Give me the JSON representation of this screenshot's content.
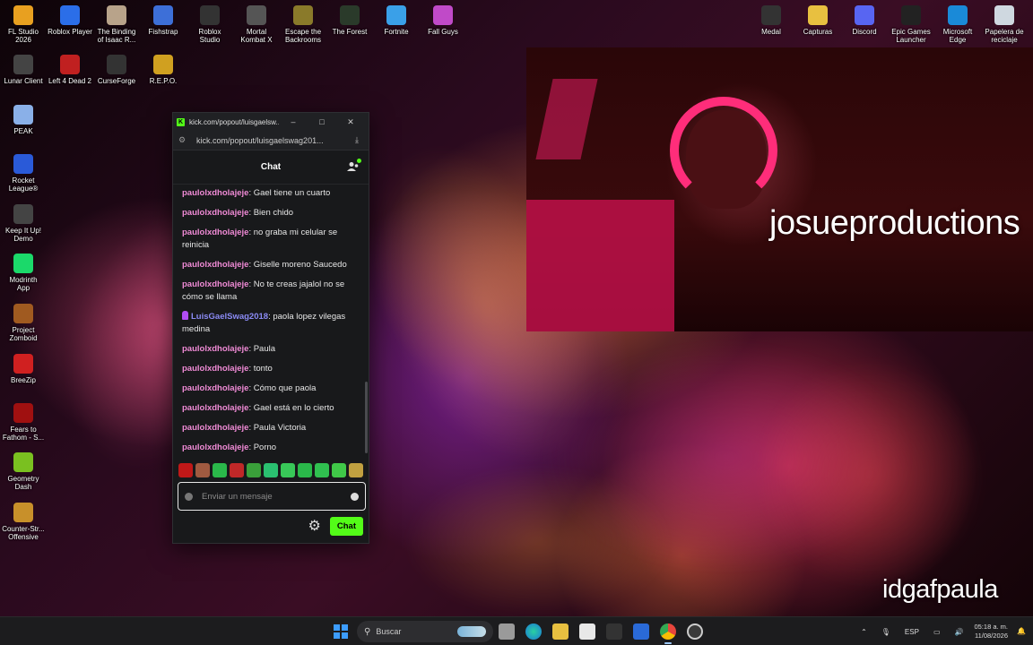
{
  "desktop": {
    "icons": [
      {
        "label": "FL Studio\n2026",
        "icon": "fl-studio-icon",
        "color": "#e8a020"
      },
      {
        "label": "Roblox Player",
        "icon": "roblox-icon",
        "color": "#2b6ee8"
      },
      {
        "label": "The Binding\nof Isaac R...",
        "icon": "isaac-icon",
        "color": "#b8a38a"
      },
      {
        "label": "Fishstrap",
        "icon": "fishstrap-icon",
        "color": "#3d6fd8"
      },
      {
        "label": "Roblox\nStudio",
        "icon": "roblox-studio-icon",
        "color": "#333"
      },
      {
        "label": "Mortal\nKombat X",
        "icon": "mortal-kombat-icon",
        "color": "#555"
      },
      {
        "label": "Escape the\nBackrooms",
        "icon": "backrooms-icon",
        "color": "#8a7a2a"
      },
      {
        "label": "The Forest",
        "icon": "the-forest-icon",
        "color": "#2a3a2a"
      },
      {
        "label": "Fortnite",
        "icon": "fortnite-icon",
        "color": "#3aa0e8"
      },
      {
        "label": "Fall Guys",
        "icon": "fall-guys-icon",
        "color": "#c04ac8"
      },
      {
        "label": "Lunar Client",
        "icon": "lunar-client-icon",
        "color": "#444"
      },
      {
        "label": "Left 4 Dead 2",
        "icon": "left4dead-icon",
        "color": "#c02020"
      },
      {
        "label": "CurseForge",
        "icon": "curseforge-icon",
        "color": "#333"
      },
      {
        "label": "R.E.P.O.",
        "icon": "repo-icon",
        "color": "#d0a020"
      },
      {
        "label": "PEAK",
        "icon": "peak-icon",
        "color": "#8ab0e8"
      },
      {
        "label": "Rocket\nLeague®",
        "icon": "rocket-league-icon",
        "color": "#2a5ad8"
      },
      {
        "label": "Keep It Up!\nDemo",
        "icon": "keep-it-up-icon",
        "color": "#444"
      },
      {
        "label": "Modrinth\nApp",
        "icon": "modrinth-icon",
        "color": "#1bd96a"
      },
      {
        "label": "Project\nZomboid",
        "icon": "zomboid-icon",
        "color": "#a05a20"
      },
      {
        "label": "BreeZip",
        "icon": "breezip-icon",
        "color": "#d02020"
      },
      {
        "label": "Fears to\nFathom - S...",
        "icon": "fears-to-fathom-icon",
        "color": "#a01010"
      },
      {
        "label": "Geometry\nDash",
        "icon": "geometry-dash-icon",
        "color": "#7ac020"
      },
      {
        "label": "Counter-Str...\nOffensive",
        "icon": "counter-strike-icon",
        "color": "#c8902a"
      },
      {
        "label": "Medal",
        "icon": "medal-icon",
        "color": "#333"
      },
      {
        "label": "Capturas",
        "icon": "folder-icon",
        "color": "#e8c040"
      },
      {
        "label": "Discord",
        "icon": "discord-icon",
        "color": "#5865f2"
      },
      {
        "label": "Epic Games\nLauncher",
        "icon": "epic-games-icon",
        "color": "#222"
      },
      {
        "label": "Microsoft\nEdge",
        "icon": "edge-icon",
        "color": "#1a8ad8"
      },
      {
        "label": "Papelera de\nreciclaje",
        "icon": "recycle-bin-icon",
        "color": "#cfd8e0"
      }
    ]
  },
  "stream": {
    "overlay_name_1": "josueproductions",
    "overlay_name_2": "idgafpaula"
  },
  "browser": {
    "tab_title": "kick.com/popout/luisgaelsw...",
    "url": "kick.com/popout/luisgaelswag201...",
    "buttons": {
      "minimize": "–",
      "maximize": "□",
      "close": "✕"
    }
  },
  "chat": {
    "header": "Chat",
    "messages": [
      {
        "user": "paulolxdholajeje",
        "text": "Gael tiene un cuarto"
      },
      {
        "user": "paulolxdholajeje",
        "text": "Bien chido"
      },
      {
        "user": "paulolxdholajeje",
        "text": "no graba mi celular se reinicia"
      },
      {
        "user": "paulolxdholajeje",
        "text": "Giselle moreno Saucedo"
      },
      {
        "user": "paulolxdholajeje",
        "text": "No te creas jajalol no se cómo se llama"
      },
      {
        "user": "LuisGaelSwag2018",
        "text": "paola lopez vilegas medina",
        "badge": true
      },
      {
        "user": "paulolxdholajeje",
        "text": "Paula"
      },
      {
        "user": "paulolxdholajeje",
        "text": "tonto"
      },
      {
        "user": "paulolxdholajeje",
        "text": "Cómo que paola"
      },
      {
        "user": "paulolxdholajeje",
        "text": "Gael está en lo cierto"
      },
      {
        "user": "paulolxdholajeje",
        "text": "Paula Victoria"
      },
      {
        "user": "paulolxdholajeje",
        "text": "Porno"
      }
    ],
    "emote_colors": [
      "#c01818",
      "#a05a40",
      "#2ab84a",
      "#c02828",
      "#3aa03a",
      "#2ac070",
      "#38c858",
      "#2ab84a",
      "#30c050",
      "#40c848",
      "#c0a040"
    ],
    "input_placeholder": "Enviar un mensaje",
    "send_label": "Chat"
  },
  "taskbar": {
    "search_placeholder": "Buscar",
    "language": "ESP",
    "time": "05:18 a. m.",
    "date": "11/08/2026"
  }
}
